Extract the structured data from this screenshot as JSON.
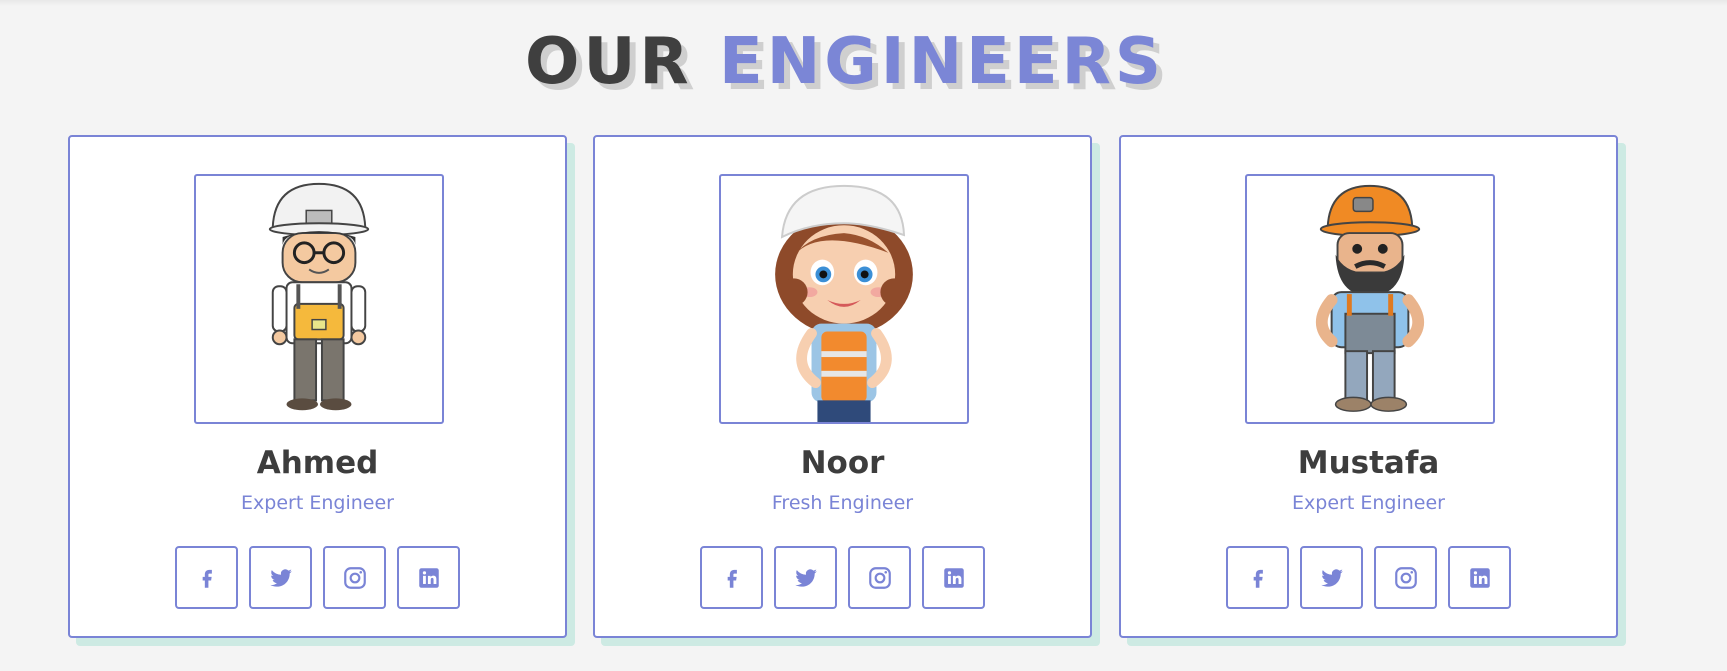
{
  "heading": {
    "word1": "OUR",
    "word2": "ENGINEERS"
  },
  "colors": {
    "accent": "#7b86d6",
    "dark": "#3f3f3f",
    "shadow": "#cdeae3"
  },
  "engineers": [
    {
      "name": "Ahmed",
      "role": "Expert Engineer",
      "avatar": "engineer-man-glasses-white-helmet"
    },
    {
      "name": "Noor",
      "role": "Fresh Engineer",
      "avatar": "engineer-woman-white-helmet-orange-vest"
    },
    {
      "name": "Mustafa",
      "role": "Expert Engineer",
      "avatar": "engineer-bearded-man-orange-helmet"
    }
  ],
  "socials": [
    "facebook-icon",
    "twitter-icon",
    "instagram-icon",
    "linkedin-icon"
  ]
}
